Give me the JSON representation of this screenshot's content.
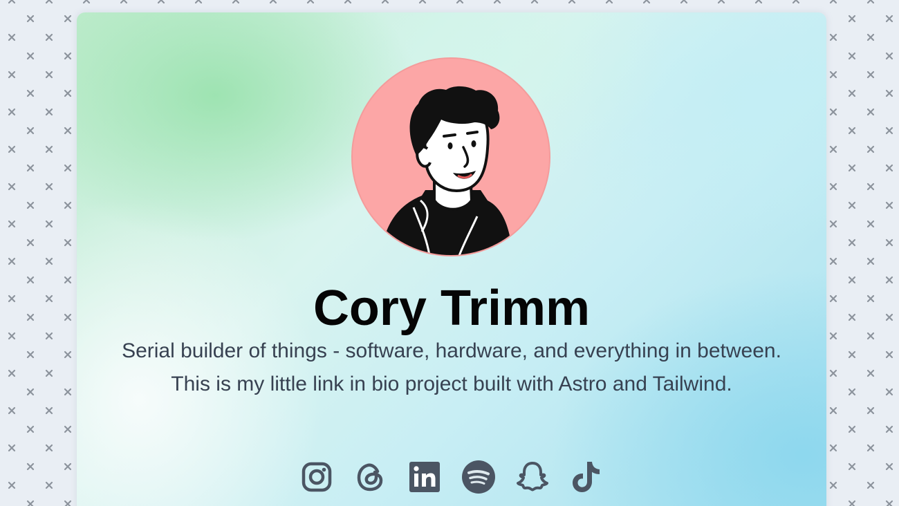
{
  "profile": {
    "name": "Cory Trimm",
    "bio": "Serial builder of things - software, hardware, and everything in between. This is my little link in bio project built with Astro and Tailwind.",
    "avatar_icon": "cartoon-avatar"
  },
  "socials": [
    {
      "icon": "instagram-icon"
    },
    {
      "icon": "threads-icon"
    },
    {
      "icon": "linkedin-icon"
    },
    {
      "icon": "spotify-icon"
    },
    {
      "icon": "snapchat-icon"
    },
    {
      "icon": "tiktok-icon"
    }
  ],
  "colors": {
    "page_background": "#e9eef4",
    "pattern_mark": "#8c939c",
    "avatar_background": "#fca6a6",
    "name_text": "#050505",
    "bio_text": "#374151",
    "icon": "#4b5563"
  }
}
